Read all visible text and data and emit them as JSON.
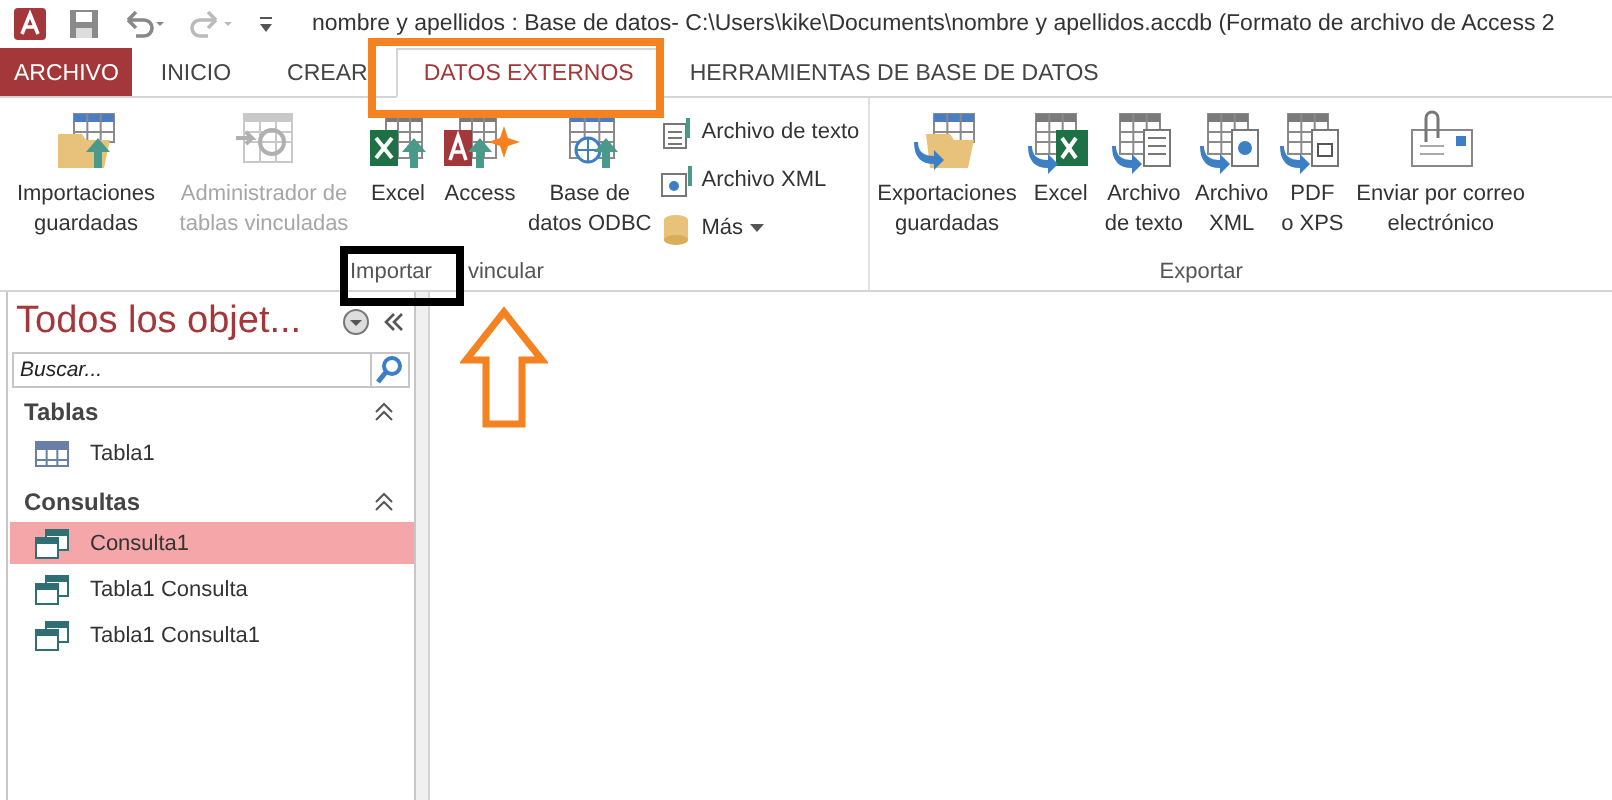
{
  "window": {
    "title": "nombre y apellidos : Base de datos- C:\\Users\\kike\\Documents\\nombre y apellidos.accdb (Formato de archivo de Access 2"
  },
  "tabs": [
    {
      "label": "ARCHIVO",
      "kind": "file",
      "selected": false
    },
    {
      "label": "INICIO",
      "kind": "tab",
      "selected": false
    },
    {
      "label": "CREAR",
      "kind": "tab",
      "selected": false
    },
    {
      "label": "DATOS EXTERNOS",
      "kind": "tab",
      "selected": true
    },
    {
      "label": "HERRAMIENTAS DE BASE DE DATOS",
      "kind": "tab",
      "selected": false
    }
  ],
  "ribbon": {
    "import_group": {
      "label_parts": [
        "Importar",
        "vincular"
      ],
      "large_buttons": [
        {
          "label": "Importaciones\nguardadas",
          "disabled": false
        },
        {
          "label": "Administrador de\ntablas vinculadas",
          "disabled": true
        },
        {
          "label": "Excel",
          "disabled": false
        },
        {
          "label": "Access",
          "disabled": false
        },
        {
          "label": "Base de\ndatos ODBC",
          "disabled": false
        }
      ],
      "small_buttons": [
        {
          "label": "Archivo de texto",
          "dropdown": false
        },
        {
          "label": "Archivo XML",
          "dropdown": false
        },
        {
          "label": "Más",
          "dropdown": true
        }
      ]
    },
    "export_group": {
      "label": "Exportar",
      "large_buttons": [
        {
          "label": "Exportaciones\nguardadas",
          "disabled": false
        },
        {
          "label": "Excel",
          "disabled": false
        },
        {
          "label": "Archivo\nde texto",
          "disabled": false
        },
        {
          "label": "Archivo\nXML",
          "disabled": false
        },
        {
          "label": "PDF\no XPS",
          "disabled": false
        },
        {
          "label": "Enviar por correo\nelectrónico",
          "disabled": false
        }
      ]
    }
  },
  "navigation_pane": {
    "title": "Todos los objet...",
    "search": {
      "placeholder": "Buscar..."
    },
    "sections": [
      {
        "title": "Tablas",
        "items": [
          {
            "label": "Tabla1",
            "kind": "table",
            "selected": false
          }
        ]
      },
      {
        "title": "Consultas",
        "items": [
          {
            "label": "Consulta1",
            "kind": "query",
            "selected": true
          },
          {
            "label": "Tabla1 Consulta",
            "kind": "query",
            "selected": false
          },
          {
            "label": "Tabla1 Consulta1",
            "kind": "query",
            "selected": false
          }
        ]
      }
    ]
  }
}
